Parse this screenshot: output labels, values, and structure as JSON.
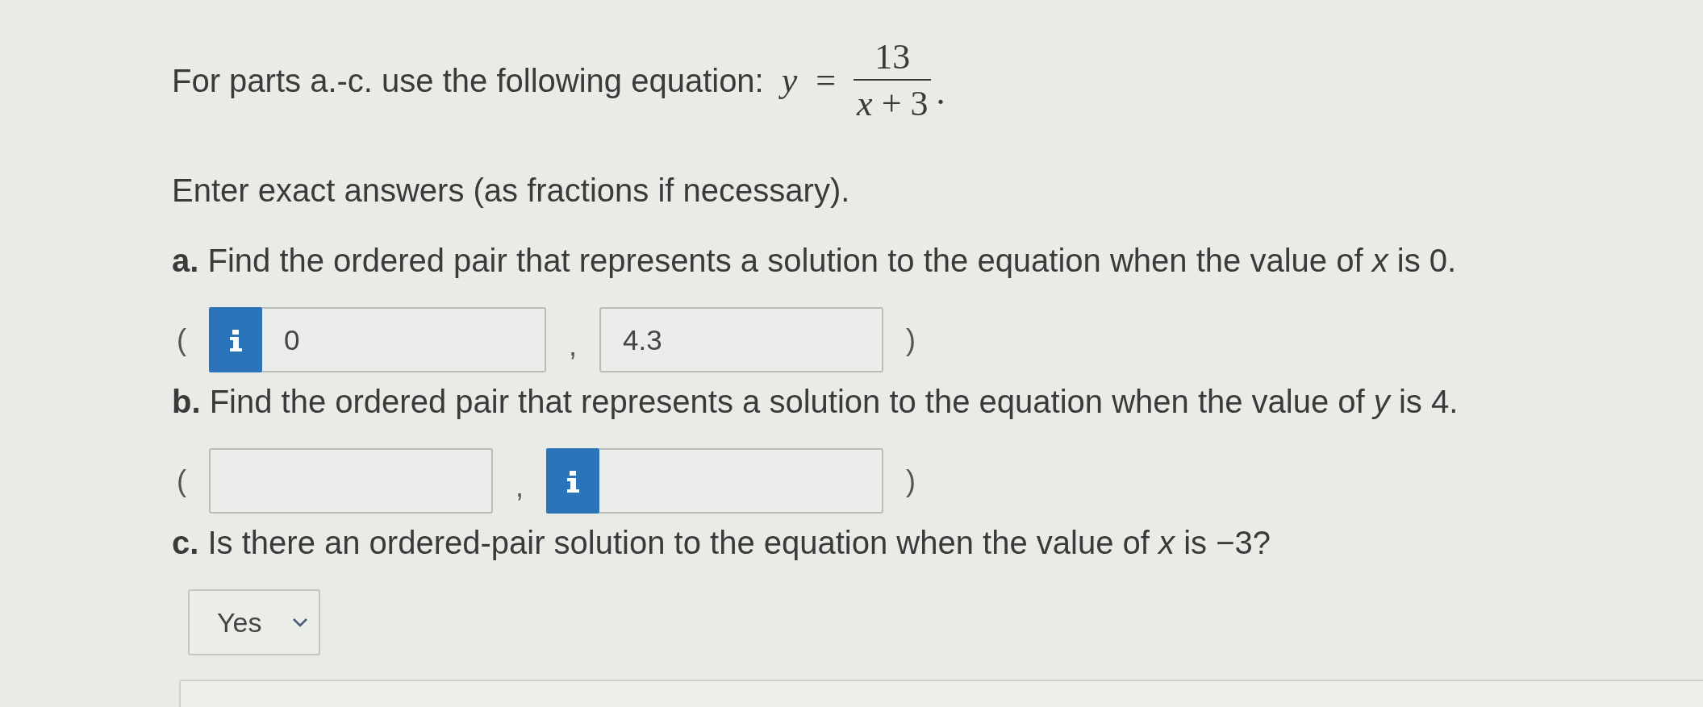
{
  "intro": {
    "text": "For parts a.-c. use the following equation:",
    "equation": {
      "lhs": "*y* =",
      "numerator": "13",
      "denominator": "*x* + 3",
      "end": "."
    }
  },
  "note": "Enter exact answers (as fractions if necessary).",
  "parts": [
    {
      "question": "**a.** Find the ordered pair that represents a solution to the equation when the value of *x* is 0.",
      "kind": "pair",
      "open": "(",
      "fields": [
        {
          "value": "0",
          "info_badge": true
        },
        {
          "value": "4.3",
          "info_badge": false
        }
      ],
      "separator": ",",
      "close": ")"
    },
    {
      "question": "**b.** Find the ordered pair that represents a solution to the equation when the value of *y* is 4.",
      "kind": "pair",
      "open": "(",
      "fields": [
        {
          "info_badge": false
        },
        {
          "info_badge": true
        }
      ],
      "separator": ",",
      "close": ")"
    },
    {
      "question": "**c.** Is there an ordered-pair solution to the equation when the value of *x* is −3?",
      "kind": "select",
      "value": "Yes"
    }
  ]
}
